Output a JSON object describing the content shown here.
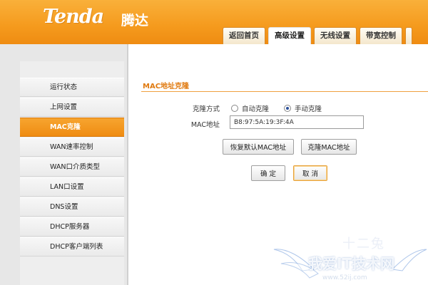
{
  "brand": {
    "logo": "Tenda",
    "logo_cn": "腾达"
  },
  "tabs": [
    "返回首页",
    "高级设置",
    "无线设置",
    "带宽控制"
  ],
  "active_tab": "高级设置",
  "sidebar": {
    "items": [
      {
        "label": "运行状态"
      },
      {
        "label": "上网设置"
      },
      {
        "label": "MAC克隆",
        "active": true
      },
      {
        "label": "WAN速率控制"
      },
      {
        "label": "WAN口介质类型"
      },
      {
        "label": "LAN口设置"
      },
      {
        "label": "DNS设置"
      },
      {
        "label": "DHCP服务器"
      },
      {
        "label": "DHCP客户端列表"
      }
    ]
  },
  "main": {
    "section_title": "MAC地址克隆",
    "clone_mode_label": "克隆方式",
    "radio_auto": "自动克隆",
    "radio_manual": "手动克隆",
    "selected_mode": "手动克隆",
    "mac_label": "MAC地址",
    "mac_value": "B8:97:5A:19:3F:4A",
    "restore_button": "恢复默认MAC地址",
    "clone_button": "克隆MAC地址",
    "ok_button": "确 定",
    "cancel_button": "取 消"
  },
  "watermark": {
    "text": "我爱IT技术网",
    "url": "www.52ij.com",
    "logo_text": "十二兔"
  },
  "colors": {
    "header_orange": "#f59a1d",
    "active_item": "#ef8c12",
    "title_orange": "#e07a10"
  }
}
